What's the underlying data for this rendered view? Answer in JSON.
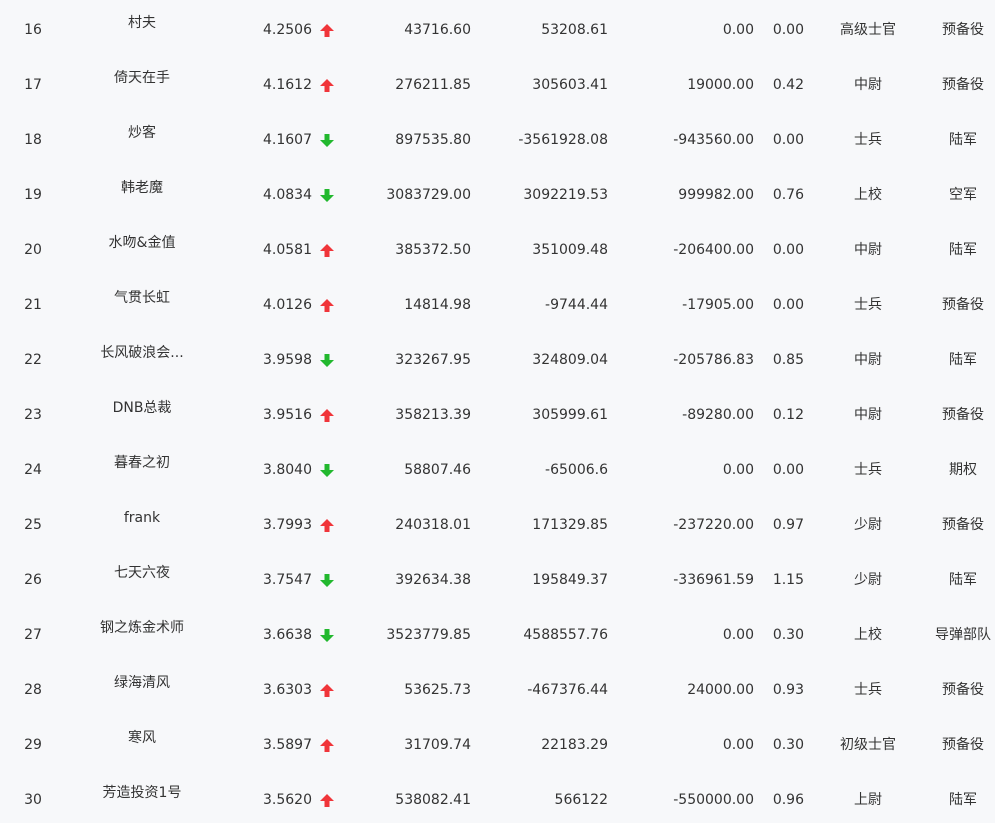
{
  "colors": {
    "up": "#f0353a",
    "down": "#22b82e",
    "text": "#333333",
    "background": "#f7f8fa"
  },
  "rows": [
    {
      "rank": "16",
      "name": "村夫",
      "score": "4.2506",
      "trend": "up",
      "total": "43716.60",
      "profit": "53208.61",
      "cash": "0.00",
      "ratio": "0.00",
      "rank_name": "高级士官",
      "army": "预备役"
    },
    {
      "rank": "17",
      "name": "倚天在手",
      "score": "4.1612",
      "trend": "up",
      "total": "276211.85",
      "profit": "305603.41",
      "cash": "19000.00",
      "ratio": "0.42",
      "rank_name": "中尉",
      "army": "预备役"
    },
    {
      "rank": "18",
      "name": "炒客",
      "score": "4.1607",
      "trend": "down",
      "total": "897535.80",
      "profit": "-3561928.08",
      "cash": "-943560.00",
      "ratio": "0.00",
      "rank_name": "士兵",
      "army": "陆军"
    },
    {
      "rank": "19",
      "name": "韩老魔",
      "score": "4.0834",
      "trend": "down",
      "total": "3083729.00",
      "profit": "3092219.53",
      "cash": "999982.00",
      "ratio": "0.76",
      "rank_name": "上校",
      "army": "空军"
    },
    {
      "rank": "20",
      "name": "水吻&金值",
      "score": "4.0581",
      "trend": "up",
      "total": "385372.50",
      "profit": "351009.48",
      "cash": "-206400.00",
      "ratio": "0.00",
      "rank_name": "中尉",
      "army": "陆军"
    },
    {
      "rank": "21",
      "name": "气贯长虹",
      "score": "4.0126",
      "trend": "up",
      "total": "14814.98",
      "profit": "-9744.44",
      "cash": "-17905.00",
      "ratio": "0.00",
      "rank_name": "士兵",
      "army": "预备役"
    },
    {
      "rank": "22",
      "name": "长风破浪会...",
      "score": "3.9598",
      "trend": "down",
      "total": "323267.95",
      "profit": "324809.04",
      "cash": "-205786.83",
      "ratio": "0.85",
      "rank_name": "中尉",
      "army": "陆军"
    },
    {
      "rank": "23",
      "name": "DNB总裁",
      "score": "3.9516",
      "trend": "up",
      "total": "358213.39",
      "profit": "305999.61",
      "cash": "-89280.00",
      "ratio": "0.12",
      "rank_name": "中尉",
      "army": "预备役"
    },
    {
      "rank": "24",
      "name": "暮春之初",
      "score": "3.8040",
      "trend": "down",
      "total": "58807.46",
      "profit": "-65006.6",
      "cash": "0.00",
      "ratio": "0.00",
      "rank_name": "士兵",
      "army": "期权"
    },
    {
      "rank": "25",
      "name": "frank",
      "score": "3.7993",
      "trend": "up",
      "total": "240318.01",
      "profit": "171329.85",
      "cash": "-237220.00",
      "ratio": "0.97",
      "rank_name": "少尉",
      "army": "预备役"
    },
    {
      "rank": "26",
      "name": "七天六夜",
      "score": "3.7547",
      "trend": "down",
      "total": "392634.38",
      "profit": "195849.37",
      "cash": "-336961.59",
      "ratio": "1.15",
      "rank_name": "少尉",
      "army": "陆军"
    },
    {
      "rank": "27",
      "name": "钢之炼金术师",
      "score": "3.6638",
      "trend": "down",
      "total": "3523779.85",
      "profit": "4588557.76",
      "cash": "0.00",
      "ratio": "0.30",
      "rank_name": "上校",
      "army": "导弹部队"
    },
    {
      "rank": "28",
      "name": "绿海清风",
      "score": "3.6303",
      "trend": "up",
      "total": "53625.73",
      "profit": "-467376.44",
      "cash": "24000.00",
      "ratio": "0.93",
      "rank_name": "士兵",
      "army": "预备役"
    },
    {
      "rank": "29",
      "name": "寒风",
      "score": "3.5897",
      "trend": "up",
      "total": "31709.74",
      "profit": "22183.29",
      "cash": "0.00",
      "ratio": "0.30",
      "rank_name": "初级士官",
      "army": "预备役"
    },
    {
      "rank": "30",
      "name": "芳造投资1号",
      "score": "3.5620",
      "trend": "up",
      "total": "538082.41",
      "profit": "566122",
      "cash": "-550000.00",
      "ratio": "0.96",
      "rank_name": "上尉",
      "army": "陆军"
    }
  ]
}
